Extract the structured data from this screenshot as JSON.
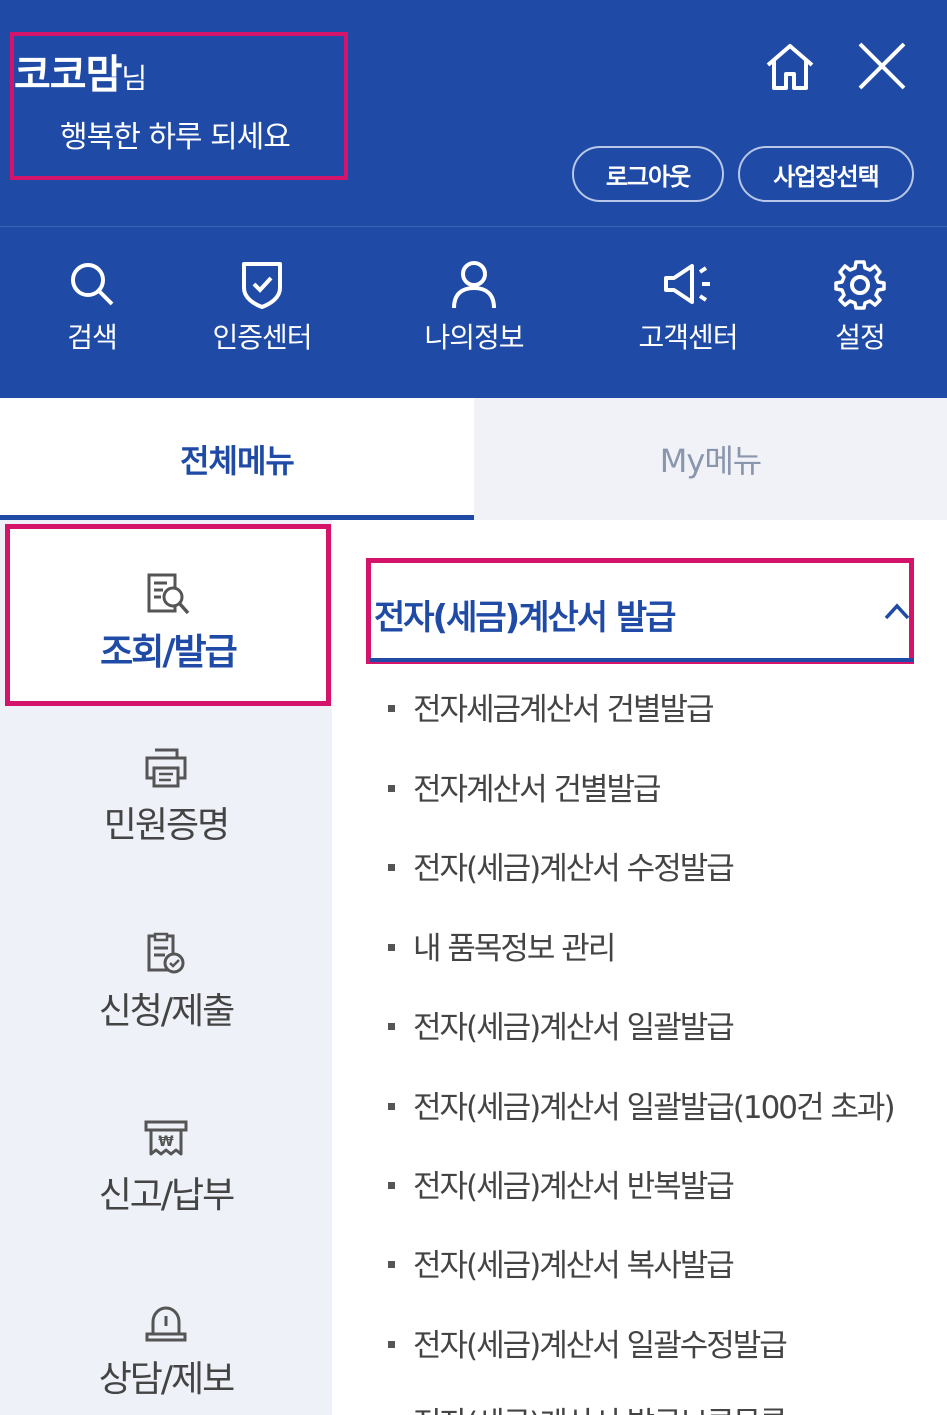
{
  "header": {
    "user_name": "코코맘",
    "user_suffix": "님",
    "greeting": "행복한 하루 되세요",
    "logout_label": "로그아웃",
    "business_select_label": "사업장선택"
  },
  "quick_menu": [
    {
      "label": "검색",
      "icon": "search-icon"
    },
    {
      "label": "인증센터",
      "icon": "shield-check-icon"
    },
    {
      "label": "나의정보",
      "icon": "user-icon"
    },
    {
      "label": "고객센터",
      "icon": "megaphone-icon"
    },
    {
      "label": "설정",
      "icon": "gear-icon"
    }
  ],
  "tabs": {
    "all": "전체메뉴",
    "my": "My메뉴"
  },
  "categories": [
    {
      "label": "조회/발급",
      "icon": "document-search-icon",
      "active": true
    },
    {
      "label": "민원증명",
      "icon": "printer-icon"
    },
    {
      "label": "신청/제출",
      "icon": "document-check-icon"
    },
    {
      "label": "신고/납부",
      "icon": "won-receipt-icon"
    },
    {
      "label": "상담/제보",
      "icon": "siren-icon"
    }
  ],
  "section": {
    "title": "전자(세금)계산서 발급",
    "expanded": true,
    "items": [
      "전자세금계산서 건별발급",
      "전자계산서 건별발급",
      "전자(세금)계산서 수정발급",
      "내 품목정보 관리",
      "전자(세금)계산서 일괄발급",
      "전자(세금)계산서 일괄발급(100건 초과)",
      "전자(세금)계산서 반복발급",
      "전자(세금)계산서 복사발급",
      "전자(세금)계산서 일괄수정발급",
      "전자(세금)계산서 발급보류목록"
    ]
  },
  "colors": {
    "primary": "#1f4aa6",
    "highlight": "#d4146a",
    "sidebar_bg": "#eef1f7"
  }
}
